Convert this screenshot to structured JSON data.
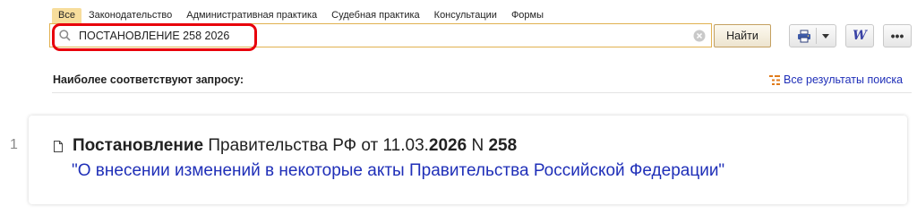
{
  "tabs": [
    "Все",
    "Законодательство",
    "Административная практика",
    "Судебная практика",
    "Консультации",
    "Формы"
  ],
  "search": {
    "query": "ПОСТАНОВЛЕНИЕ 258 2026",
    "find_label": "Найти"
  },
  "toolbar": {
    "word_label": "W",
    "more_label": "•••"
  },
  "results": {
    "heading": "Наиболее соответствуют запросу:",
    "all_results_label": "Все результаты поиска"
  },
  "result_item": {
    "number": "1",
    "title_bold_1": "Постановление",
    "title_regular_1": " Правительства РФ от 11.03.",
    "title_bold_2": "2026",
    "title_regular_2": " N ",
    "title_bold_3": "258",
    "subtitle": "\"О внесении изменений в некоторые акты Правительства Российской Федерации\""
  },
  "colors": {
    "active_tab": "#f7dd9c",
    "highlight_border": "#e8000b",
    "link": "#1f2fb8",
    "search_border": "#e1b150"
  },
  "icons": [
    "search-icon",
    "clear-icon",
    "print-icon",
    "chevron-down-icon",
    "word-icon",
    "more-icon",
    "tree-list-icon",
    "document-icon"
  ]
}
